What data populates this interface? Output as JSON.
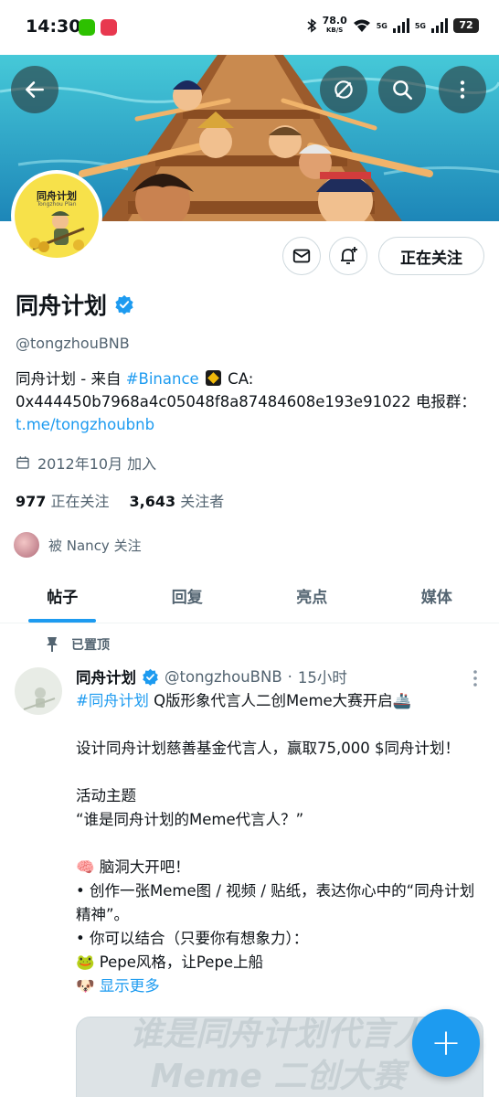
{
  "status_bar": {
    "time": "14:30",
    "net_speed": "78.0",
    "net_unit": "KB/S",
    "network_1": "5G",
    "network_2": "5G",
    "battery": "72"
  },
  "header": {
    "back_icon": "arrow-left-icon",
    "hide_icon": "eye-slash-icon",
    "search_icon": "search-icon",
    "more_icon": "more-vertical-icon"
  },
  "profile": {
    "avatar_title": "同舟计划",
    "avatar_subtitle": "Tongzhou Plan",
    "display_name": "同舟计划",
    "handle": "@tongzhouBNB",
    "bio": {
      "prefix": "同舟计划 - 来自 ",
      "hashtag": "#Binance",
      "middle": " CA: 0x444450b7968a4c05048f8a87484608e193e91022 电报群：",
      "link": "t.me/tongzhoubnb"
    },
    "joined": "2012年10月 加入",
    "following_count": "977",
    "following_label": "正在关注",
    "followers_count": "3,643",
    "followers_label": "关注者",
    "followed_by": "被 Nancy 关注",
    "follow_button": "正在关注",
    "verified_color": "#1d9bf0"
  },
  "tabs": [
    {
      "label": "帖子",
      "active": true
    },
    {
      "label": "回复",
      "active": false
    },
    {
      "label": "亮点",
      "active": false
    },
    {
      "label": "媒体",
      "active": false
    }
  ],
  "pinned_post": {
    "pinned_label": "已置顶",
    "author_name": "同舟计划",
    "author_handle": "@tongzhouBNB",
    "separator": "·",
    "time": "15小时",
    "hashtag": "#同舟计划",
    "headline": " Q版形象代言人二创Meme大赛开启🚢",
    "body": "\n\n设计同舟计划慈善基金代言人，赢取75,000 $同舟计划！\n\n活动主题\n“谁是同舟计划的Meme代言人？”\n\n🧠 脑洞大开吧！\n• 创作一张Meme图 / 视频 / 贴纸，表达你心中的“同舟计划精神”。\n• 你可以结合（只要你有想象力）：\n🐸 Pepe风格，让Pepe上船\n🐶 ",
    "show_more": "显示更多",
    "media_line1": "谁是同舟计划代言人",
    "media_line2": "Meme 二创大赛"
  },
  "fab": {
    "label": "+"
  },
  "colors": {
    "accent": "#1d9bf0",
    "text_primary": "#0f1419",
    "text_secondary": "#536471"
  }
}
